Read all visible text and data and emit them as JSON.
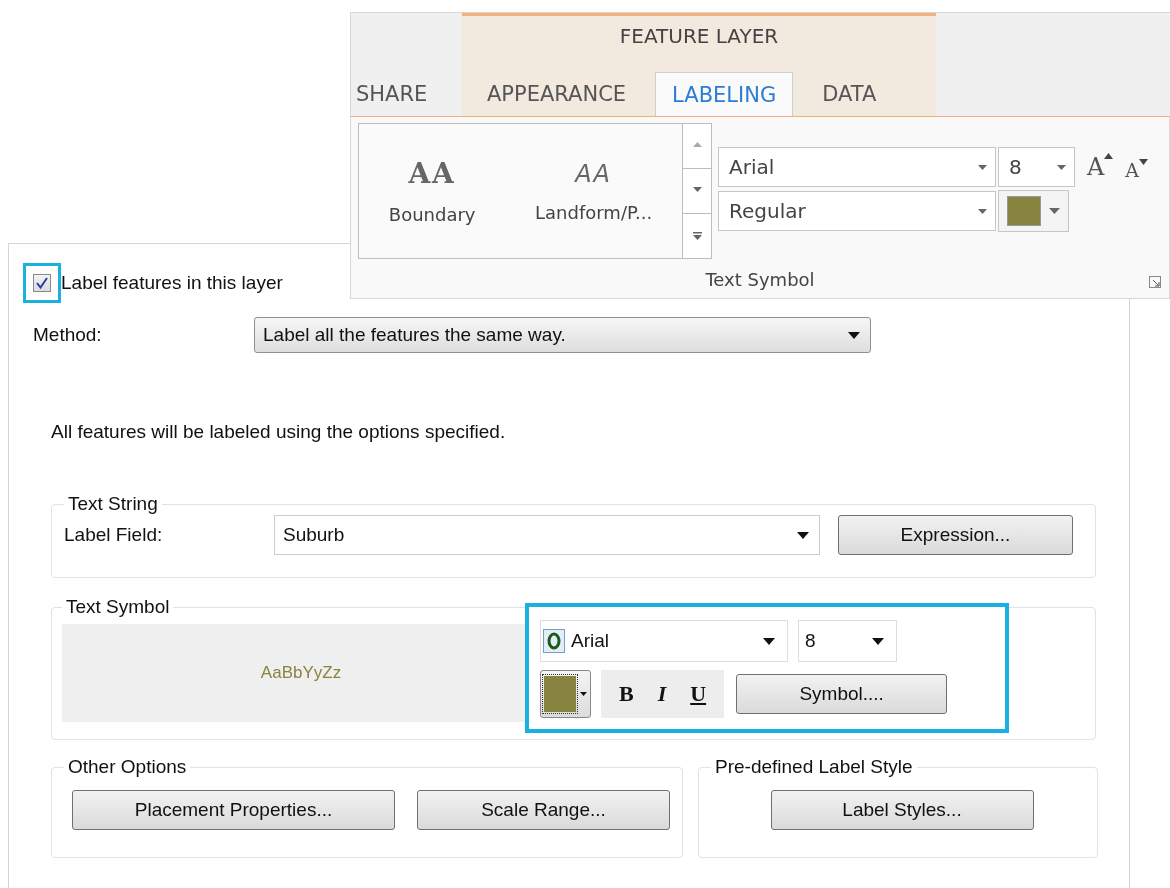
{
  "ribbon": {
    "context_header": "FEATURE LAYER",
    "tabs": [
      {
        "label": "SHARE",
        "contextual": false,
        "selected": false
      },
      {
        "label": "APPEARANCE",
        "contextual": true,
        "selected": false
      },
      {
        "label": "LABELING",
        "contextual": true,
        "selected": true
      },
      {
        "label": "DATA",
        "contextual": true,
        "selected": false
      }
    ],
    "gallery": [
      {
        "sample": "AA",
        "kind": "serif",
        "label": "Boundary"
      },
      {
        "sample": "AA",
        "kind": "italic",
        "label": "Landform/P..."
      }
    ],
    "font": "Arial",
    "size": "8",
    "grow_font": "A",
    "shrink_font": "A",
    "font_style": "Regular",
    "group_label": "Text Symbol"
  },
  "dialog": {
    "label_checkbox": {
      "label": "Label features in this layer",
      "checked": true
    },
    "method": {
      "label": "Method:",
      "value": "Label all the features the same way."
    },
    "description": "All features will be labeled using the options specified.",
    "text_string": {
      "legend": "Text String",
      "field_label": "Label Field:",
      "field_value": "Suburb",
      "button": "Expression..."
    },
    "text_symbol": {
      "legend": "Text Symbol",
      "preview": "AaBbYyZz",
      "font": "Arial",
      "size": "8",
      "color": "#878440",
      "bold": "B",
      "italic": "I",
      "underline": "U",
      "button": "Symbol...."
    },
    "other_options": {
      "legend": "Other Options",
      "buttons": [
        "Placement Properties...",
        "Scale Range..."
      ]
    },
    "predefined": {
      "legend": "Pre-defined Label Style",
      "button": "Label Styles..."
    }
  }
}
